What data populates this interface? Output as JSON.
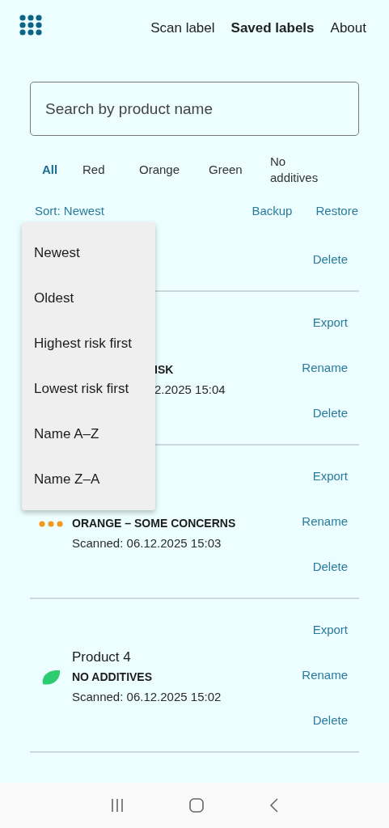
{
  "nav": [
    {
      "label": "Scan label",
      "selected": false
    },
    {
      "label": "Saved labels",
      "selected": true
    },
    {
      "label": "About",
      "selected": false
    }
  ],
  "search": {
    "placeholder": "Search by product name"
  },
  "filters": [
    {
      "label": "All",
      "selected": true
    },
    {
      "label": "Red",
      "selected": false
    },
    {
      "label": "Orange",
      "selected": false
    },
    {
      "label": "Green",
      "selected": false
    },
    {
      "label": "No additives",
      "selected": false
    }
  ],
  "sort": {
    "label": "Sort: Newest"
  },
  "backup": "Backup",
  "restore": "Restore",
  "items": [
    {
      "kind": "clipped",
      "actions": [
        "Delete"
      ]
    },
    {
      "kind": "covered",
      "label": "ISK",
      "scanned": "2.2025 15:04",
      "actions": [
        "Export",
        "Rename",
        "Delete"
      ]
    },
    {
      "kind": "orange",
      "label": "ORANGE – SOME CONCERNS",
      "scanned": "Scanned: 06.12.2025 15:03",
      "actions": [
        "Export",
        "Rename",
        "Delete"
      ]
    },
    {
      "kind": "green",
      "name": "Product 4",
      "label": "NO ADDITIVES",
      "scanned": "Scanned: 06.12.2025 15:02",
      "actions": [
        "Export",
        "Rename",
        "Delete"
      ]
    }
  ],
  "sort_menu": [
    {
      "label": "Newest"
    },
    {
      "label": "Oldest"
    },
    {
      "label": "Highest risk first"
    },
    {
      "label": "Lowest risk first"
    },
    {
      "label": "Name A–Z"
    },
    {
      "label": "Name Z–A"
    }
  ]
}
